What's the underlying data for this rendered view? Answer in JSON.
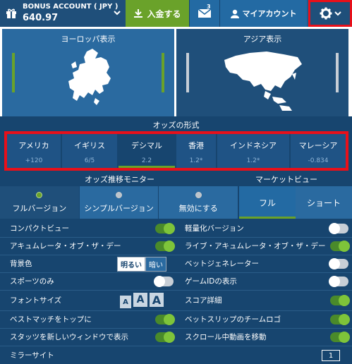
{
  "header": {
    "account_name": "BONUS ACCOUNT ( JPY )",
    "balance": "640.97",
    "deposit_label": "入金する",
    "messages_count": "3",
    "my_account_label": "マイアカウント",
    "colors": {
      "deposit": "#6aa22a",
      "highlight": "#e8101a"
    }
  },
  "maps": {
    "europe_label": "ヨーロッパ表示",
    "asia_label": "アジア表示"
  },
  "odds_format": {
    "title": "オッズの形式",
    "options": [
      {
        "label": "アメリカ",
        "value": "+120"
      },
      {
        "label": "イギリス",
        "value": "6/5"
      },
      {
        "label": "デシマル",
        "value": "2.2"
      },
      {
        "label": "香港",
        "value": "1.2*"
      },
      {
        "label": "インドネシア",
        "value": "1.2*"
      },
      {
        "label": "マレーシア",
        "value": "-0.834"
      }
    ],
    "selected": "デシマル"
  },
  "odds_monitor": {
    "title": "オッズ推移モニター",
    "tabs": [
      "フルバージョン",
      "シンプルバージョン",
      "無効にする"
    ],
    "selected": "フルバージョン"
  },
  "market_view": {
    "title": "マーケットビュー",
    "tabs": [
      "フル",
      "ショート"
    ],
    "selected": "フル"
  },
  "settings": {
    "compact_view": "コンパクトビュー",
    "lite_version": "軽量化バージョン",
    "accumulator_day": "アキュムレータ・オブ・ザ・デー",
    "live_accumulator_day": "ライブ・アキュムレータ・オブ・ザ・デー",
    "background_color": "背景色",
    "bg_light": "明るい",
    "bg_dark": "暗い",
    "bet_generator": "ベットジェネレーター",
    "sports_only": "スポーツのみ",
    "game_id_display": "ゲームIDの表示",
    "font_size": "フォントサイズ",
    "font_a": "A",
    "score_details": "スコア詳細",
    "best_match_top": "ベストマッチをトップに",
    "betslip_team_logo": "ベットスリップのチームロゴ",
    "stats_new_window": "スタッツを新しいウィンドウで表示",
    "scroll_video_move": "スクロール中動画を移動",
    "mirror_site": "ミラーサイト",
    "mirror_number": "1"
  }
}
